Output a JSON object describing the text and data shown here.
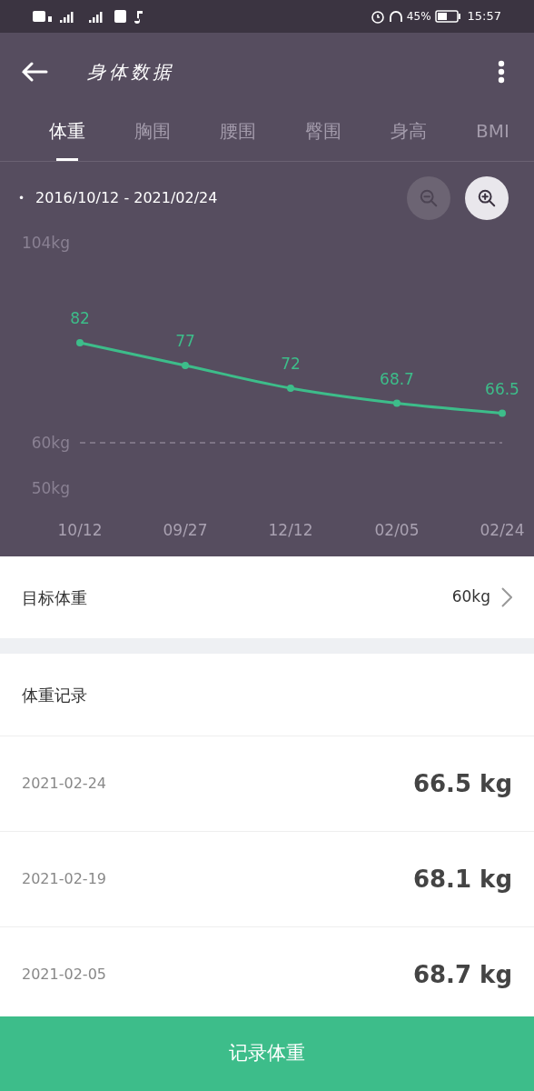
{
  "status_bar": {
    "battery_percent": "45%",
    "time": "15:57"
  },
  "header": {
    "title": "身体数据"
  },
  "tabs": [
    {
      "label": "体重",
      "selected": true
    },
    {
      "label": "胸围",
      "selected": false
    },
    {
      "label": "腰围",
      "selected": false
    },
    {
      "label": "臀围",
      "selected": false
    },
    {
      "label": "身高",
      "selected": false
    },
    {
      "label": "BMI",
      "selected": false
    }
  ],
  "range_bullet": "•",
  "range": "2016/10/12 - 2021/02/24",
  "zoom_out": {
    "disabled": true
  },
  "zoom_in": {
    "disabled": false
  },
  "chart_data": {
    "type": "line",
    "categories": [
      "10/12",
      "09/27",
      "12/12",
      "02/05",
      "02/24"
    ],
    "series": [
      {
        "color": "#3dbd8a",
        "marker": "circle",
        "values": [
          82,
          77,
          72,
          68.7,
          66.5
        ]
      }
    ],
    "ylim": [
      50,
      104
    ],
    "yticks": [
      {
        "value": 104,
        "label": "104kg"
      },
      {
        "value": 60,
        "label": "60kg"
      },
      {
        "value": 50,
        "label": "50kg"
      }
    ],
    "data_labels": true
  },
  "target": {
    "label": "目标体重",
    "value": "60kg"
  },
  "records": {
    "title": "体重记录",
    "rows": [
      {
        "date": "2021-02-24",
        "weight": "66.5 kg"
      },
      {
        "date": "2021-02-19",
        "weight": "68.1 kg"
      },
      {
        "date": "2021-02-05",
        "weight": "68.7 kg"
      }
    ]
  },
  "record_button": "记录体重"
}
